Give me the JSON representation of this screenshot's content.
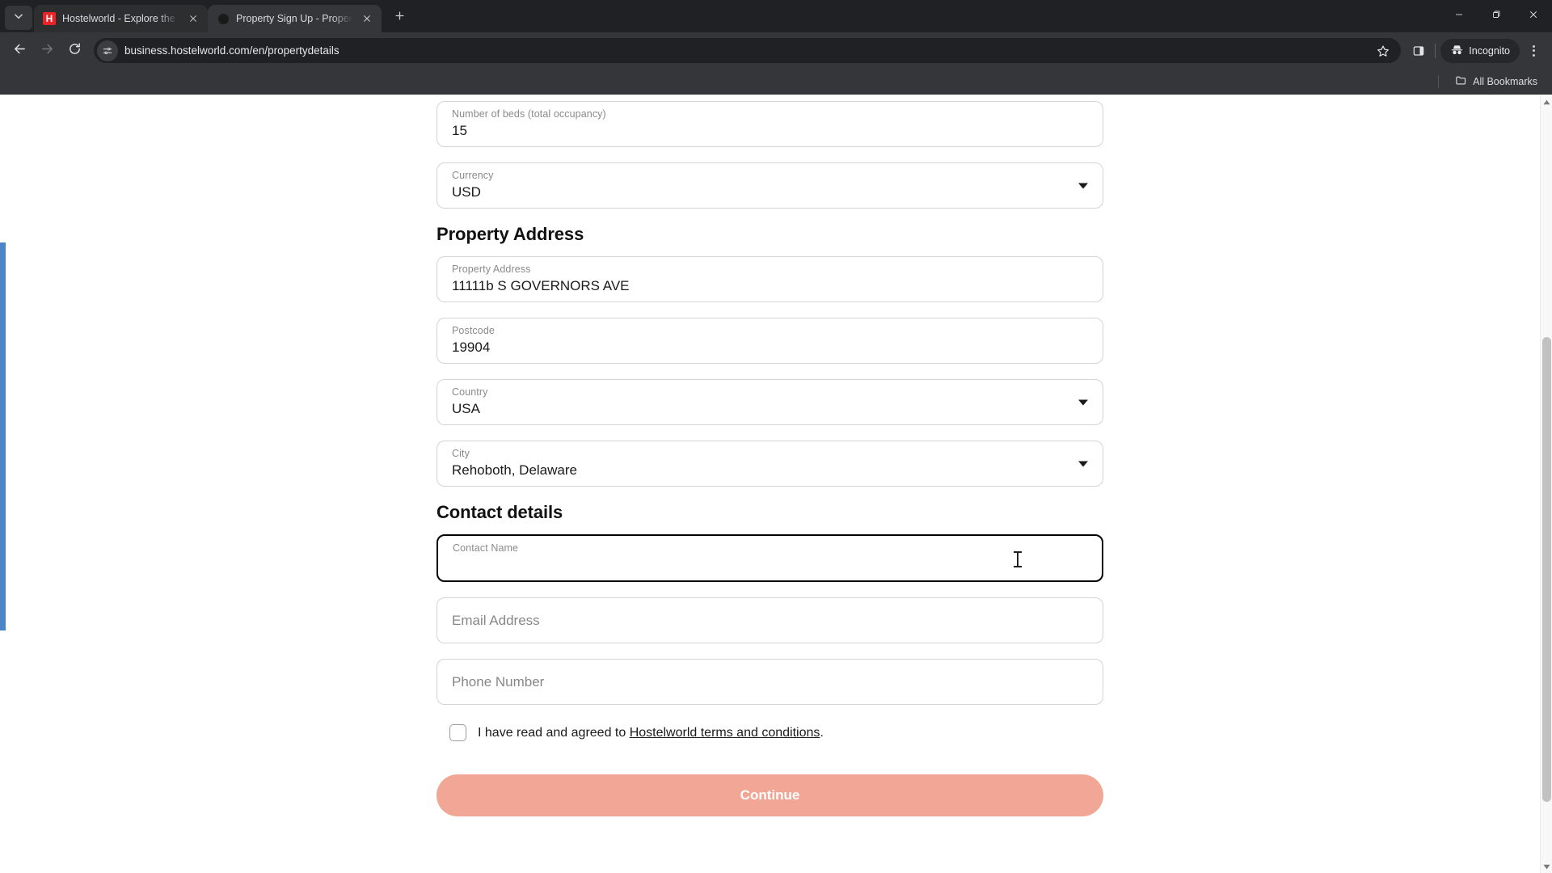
{
  "browser": {
    "tab_search_icon": "chevron-down-icon",
    "tabs": [
      {
        "title": "Hostelworld - Explore the world",
        "favicon": "hostelworld-h-icon",
        "active": false
      },
      {
        "title": "Property Sign Up - Property and",
        "favicon": "loading-dot-icon",
        "active": true
      }
    ],
    "new_tab_label": "+",
    "window_controls": [
      "minimize",
      "maximize",
      "close"
    ],
    "nav": {
      "back": "back-icon",
      "forward": "forward-icon",
      "reload": "reload-icon"
    },
    "omnibox": {
      "site_icon": "site-settings-icon",
      "url": "business.hostelworld.com/en/propertydetails",
      "bookmark_icon": "star-icon",
      "side_panel_icon": "side-panel-icon"
    },
    "incognito": {
      "label": "Incognito",
      "icon": "incognito-icon"
    },
    "menu_icon": "three-dots-menu-icon",
    "bookmarks": {
      "all_bookmarks_label": "All Bookmarks",
      "folder_icon": "folder-icon"
    }
  },
  "page": {
    "fields": {
      "beds": {
        "label": "Number of beds (total occupancy)",
        "value": "15"
      },
      "currency": {
        "label": "Currency",
        "value": "USD"
      },
      "property_address": {
        "label": "Property Address",
        "value": "11111b S GOVERNORS AVE"
      },
      "postcode": {
        "label": "Postcode",
        "value": "19904"
      },
      "country": {
        "label": "Country",
        "value": "USA"
      },
      "city": {
        "label": "City",
        "value": "Rehoboth, Delaware"
      },
      "contact_name": {
        "label": "Contact Name",
        "value": ""
      },
      "email": {
        "placeholder": "Email Address",
        "value": ""
      },
      "phone": {
        "placeholder": "Phone Number",
        "value": ""
      }
    },
    "sections": {
      "property_address": "Property Address",
      "contact_details": "Contact details"
    },
    "terms": {
      "prefix": "I have read and agreed to ",
      "link": "Hostelworld terms and conditions",
      "suffix": ".",
      "checked": false
    },
    "continue_label": "Continue",
    "accent_color": "#f2a695",
    "focus_border_color": "#000000",
    "left_indicator_color": "#4a86c8"
  }
}
